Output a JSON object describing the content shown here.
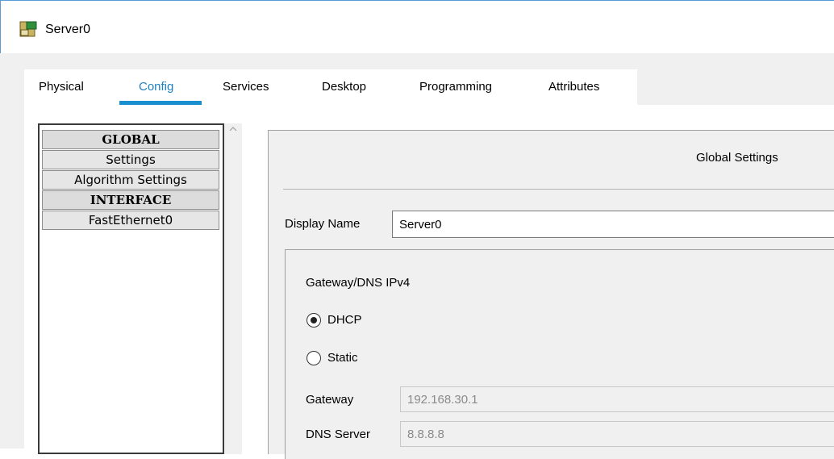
{
  "window": {
    "title": "Server0",
    "icon": "server-icon"
  },
  "tabs": [
    {
      "label": "Physical",
      "active": false
    },
    {
      "label": "Config",
      "active": true
    },
    {
      "label": "Services",
      "active": false
    },
    {
      "label": "Desktop",
      "active": false
    },
    {
      "label": "Programming",
      "active": false
    },
    {
      "label": "Attributes",
      "active": false
    }
  ],
  "sidebar": {
    "items": [
      {
        "label": "GLOBAL",
        "type": "header"
      },
      {
        "label": "Settings",
        "type": "item"
      },
      {
        "label": "Algorithm Settings",
        "type": "item"
      },
      {
        "label": "INTERFACE",
        "type": "header"
      },
      {
        "label": "FastEthernet0",
        "type": "item"
      }
    ]
  },
  "settings": {
    "title": "Global Settings",
    "display_name_label": "Display Name",
    "display_name_value": "Server0",
    "gateway_dns": {
      "heading": "Gateway/DNS IPv4",
      "mode_options": [
        "DHCP",
        "Static"
      ],
      "selected_mode": "DHCP",
      "gateway_label": "Gateway",
      "gateway_value": "192.168.30.1",
      "dns_label": "DNS Server",
      "dns_value": "8.8.8.8"
    }
  },
  "colors": {
    "accent": "#1a8fd0",
    "active_tab_text": "#1f7fc0",
    "panel_background": "#f0f0f0"
  }
}
